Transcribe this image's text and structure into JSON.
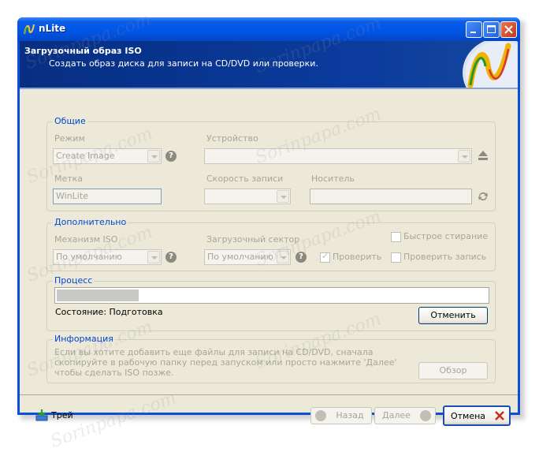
{
  "window": {
    "title": "nLite"
  },
  "header": {
    "title": "Загрузочный образ ISO",
    "subtitle": "Создать образ диска для записи на CD/DVD или проверки."
  },
  "general": {
    "legend": "Общие",
    "mode_label": "Режим",
    "mode_value": "Create Image",
    "device_label": "Устройство",
    "device_value": "",
    "label_label": "Метка",
    "label_value": "WinLite",
    "speed_label": "Скорость записи",
    "speed_value": "",
    "media_label": "Носитель",
    "media_value": ""
  },
  "advanced": {
    "legend": "Дополнительно",
    "iso_engine_label": "Механизм ISO",
    "iso_engine_value": "По умолчанию",
    "boot_sector_label": "Загрузочный сектор",
    "boot_sector_value": "По умолчанию",
    "quick_erase_label": "Быстрое стирание",
    "verify_label": "Проверить",
    "verify_write_label": "Проверить запись",
    "verify_checked": true
  },
  "process": {
    "legend": "Процесс",
    "progress_fraction": 0.19,
    "status_text": "Состояние: Подготовка",
    "cancel_label": "Отменить"
  },
  "info": {
    "legend": "Информация",
    "text": "Если вы хотите добавить еще файлы для записи на CD/DVD, сначала скопируйте в рабочую папку перед запуском или просто нажмите 'Далее' чтобы сделать ISO позже.",
    "browse_label": "Обзор"
  },
  "footer": {
    "tray_label": "Трей",
    "back_label": "Назад",
    "next_label": "Далее",
    "cancel_label": "Отмена"
  },
  "colors": {
    "titlebar": "#0055e5",
    "header": "#0b3c9e",
    "accent_legend": "#0046d5",
    "close_x": "#c62b1e"
  }
}
